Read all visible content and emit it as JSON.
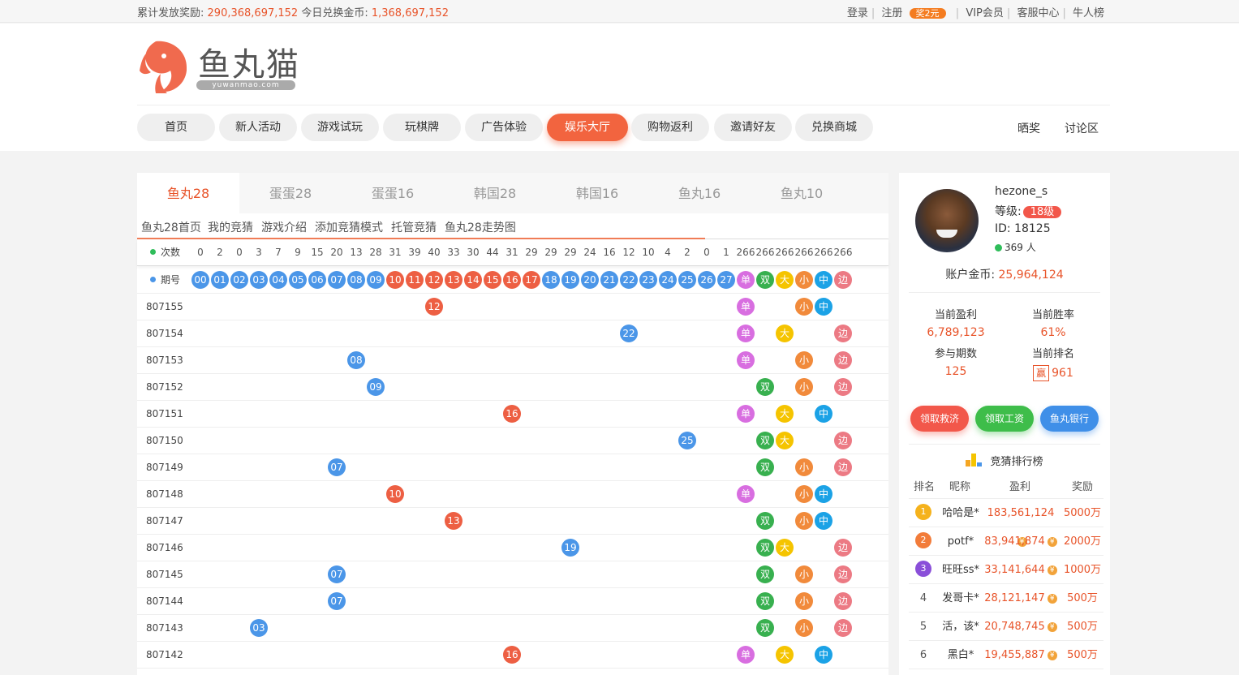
{
  "topbar": {
    "total_prize_label": "累计发放奖励:",
    "total_prize_value": "290,368,697,152",
    "today_label": "今日兑换金币:",
    "today_value": "1,368,697,152",
    "login": "登录",
    "register": "注册",
    "register_badge": "奖2元",
    "vip": "VIP会员",
    "service": "客服中心",
    "leaderboard": "牛人榜"
  },
  "logo": {
    "title": "鱼丸猫",
    "subtitle": "yuwanmao.com"
  },
  "nav": {
    "items": [
      "首页",
      "新人活动",
      "游戏试玩",
      "玩棋牌",
      "广告体验",
      "娱乐大厅",
      "购物返利",
      "邀请好友",
      "兑换商城"
    ],
    "active_index": 5,
    "right": [
      "晒奖",
      "讨论区"
    ]
  },
  "game_tabs": {
    "items": [
      "鱼丸28",
      "蛋蛋28",
      "蛋蛋16",
      "韩国28",
      "韩国16",
      "鱼丸16",
      "鱼丸10"
    ],
    "active_index": 0
  },
  "subnav": [
    "鱼丸28首页",
    "我的竞猜",
    "游戏介绍",
    "添加竞猜模式",
    "托管竞猜",
    "鱼丸28走势图"
  ],
  "trend": {
    "count_label": "次数",
    "counts": [
      "0",
      "2",
      "0",
      "3",
      "7",
      "9",
      "15",
      "20",
      "13",
      "28",
      "31",
      "39",
      "40",
      "33",
      "30",
      "44",
      "31",
      "29",
      "29",
      "29",
      "24",
      "16",
      "12",
      "10",
      "4",
      "2",
      "0",
      "1",
      "266",
      "266",
      "266",
      "266",
      "266",
      "266"
    ],
    "issue_label": "期号",
    "headers": [
      "00",
      "01",
      "02",
      "03",
      "04",
      "05",
      "06",
      "07",
      "08",
      "09",
      "10",
      "11",
      "12",
      "13",
      "14",
      "15",
      "16",
      "17",
      "18",
      "19",
      "20",
      "21",
      "22",
      "23",
      "24",
      "25",
      "26",
      "27",
      "单",
      "双",
      "大",
      "小",
      "中",
      "边"
    ],
    "rows": [
      {
        "issue": "807155",
        "num": "12",
        "odd": "单",
        "even": "",
        "big": "",
        "small": "小",
        "mid": "中",
        "edge": ""
      },
      {
        "issue": "807154",
        "num": "22",
        "odd": "单",
        "even": "",
        "big": "大",
        "small": "",
        "mid": "",
        "edge": "边"
      },
      {
        "issue": "807153",
        "num": "08",
        "odd": "单",
        "even": "",
        "big": "",
        "small": "小",
        "mid": "",
        "edge": "边"
      },
      {
        "issue": "807152",
        "num": "09",
        "odd": "",
        "even": "双",
        "big": "",
        "small": "小",
        "mid": "",
        "edge": "边"
      },
      {
        "issue": "807151",
        "num": "16",
        "odd": "单",
        "even": "",
        "big": "大",
        "small": "",
        "mid": "中",
        "edge": ""
      },
      {
        "issue": "807150",
        "num": "25",
        "odd": "",
        "even": "双",
        "big": "大",
        "small": "",
        "mid": "",
        "edge": "边"
      },
      {
        "issue": "807149",
        "num": "07",
        "odd": "",
        "even": "双",
        "big": "",
        "small": "小",
        "mid": "",
        "edge": "边"
      },
      {
        "issue": "807148",
        "num": "10",
        "odd": "单",
        "even": "",
        "big": "",
        "small": "小",
        "mid": "中",
        "edge": ""
      },
      {
        "issue": "807147",
        "num": "13",
        "odd": "",
        "even": "双",
        "big": "",
        "small": "小",
        "mid": "中",
        "edge": ""
      },
      {
        "issue": "807146",
        "num": "19",
        "odd": "",
        "even": "双",
        "big": "大",
        "small": "",
        "mid": "",
        "edge": "边"
      },
      {
        "issue": "807145",
        "num": "07",
        "odd": "",
        "even": "双",
        "big": "",
        "small": "小",
        "mid": "",
        "edge": "边"
      },
      {
        "issue": "807144",
        "num": "07",
        "odd": "",
        "even": "双",
        "big": "",
        "small": "小",
        "mid": "",
        "edge": "边"
      },
      {
        "issue": "807143",
        "num": "03",
        "odd": "",
        "even": "双",
        "big": "",
        "small": "小",
        "mid": "",
        "edge": "边"
      },
      {
        "issue": "807142",
        "num": "16",
        "odd": "单",
        "even": "",
        "big": "大",
        "small": "",
        "mid": "中",
        "edge": ""
      }
    ]
  },
  "user": {
    "name": "hezone_s",
    "level_label": "等级:",
    "level": "18级",
    "id": "ID: 18125",
    "online": "369 人",
    "coins_label": "账户金币:",
    "coins": "25,964,124",
    "profit_label": "当前盈利",
    "profit": "6,789,123",
    "winrate_label": "当前胜率",
    "winrate": "61%",
    "periods_label": "参与期数",
    "periods": "125",
    "rank_label": "当前排名",
    "rank_tag": "赢",
    "rank": "961",
    "btn_rescue": "领取救济",
    "btn_salary": "领取工资",
    "btn_bank": "鱼丸银行"
  },
  "ranking": {
    "title": "竞猜排行榜",
    "headers": [
      "排名",
      "昵称",
      "盈利",
      "奖励"
    ],
    "rows": [
      {
        "rank": "1",
        "name": "哈哈是*",
        "profit": "183,561,124",
        "reward": "5000万"
      },
      {
        "rank": "2",
        "name": "potf*",
        "profit": "83,941,874",
        "reward": "2000万"
      },
      {
        "rank": "3",
        "name": "旺旺ss*",
        "profit": "33,141,644",
        "reward": "1000万"
      },
      {
        "rank": "4",
        "name": "发哥卡*",
        "profit": "28,121,147",
        "reward": "500万"
      },
      {
        "rank": "5",
        "name": "活，该*",
        "profit": "20,748,745",
        "reward": "500万"
      },
      {
        "rank": "6",
        "name": "黑白*",
        "profit": "19,455,887",
        "reward": "500万"
      }
    ]
  },
  "colors": {
    "accent": "#e8542a",
    "ball_blue": "#4b96e8",
    "ball_red": "#ed5f43"
  }
}
